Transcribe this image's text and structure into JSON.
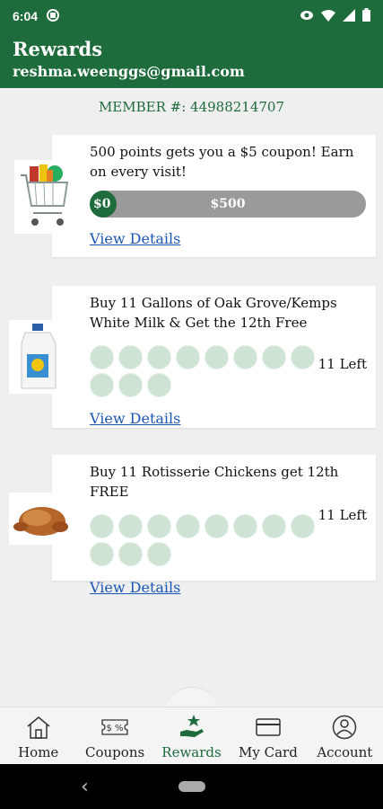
{
  "status": {
    "time": "6:04",
    "icons": [
      "media-icon",
      "eye-icon",
      "wifi-icon",
      "signal-icon",
      "battery-icon"
    ]
  },
  "header": {
    "title": "Rewards",
    "email": "reshma.weenggs@gmail.com"
  },
  "member": {
    "label": "MEMBER #: 44988214707"
  },
  "cards": [
    {
      "title": "500 points gets you a $5 coupon! Earn on every visit!",
      "image": "shopping-cart-image",
      "progress_start": "$0",
      "progress_end": "$500",
      "progress_fraction": 0.03,
      "link": "View Details"
    },
    {
      "title": "Buy 11 Gallons of Oak Grove/Kemps White Milk & Get the 12th Free",
      "image": "milk-gallon-image",
      "stamps_total": 11,
      "stamps_filled": 0,
      "left_text": "11 Left",
      "link": "View Details"
    },
    {
      "title": "Buy 11 Rotisserie Chickens get 12th FREE",
      "image": "rotisserie-chicken-image",
      "stamps_total": 11,
      "stamps_filled": 0,
      "left_text": "11 Left",
      "link": "View Details"
    }
  ],
  "nav": {
    "items": [
      {
        "label": "Home",
        "icon": "home-icon"
      },
      {
        "label": "Coupons",
        "icon": "coupon-icon"
      },
      {
        "label": "Rewards",
        "icon": "rewards-hand-star-icon"
      },
      {
        "label": "My Card",
        "icon": "card-icon"
      },
      {
        "label": "Account",
        "icon": "account-icon"
      }
    ],
    "active": "Rewards"
  },
  "colors": {
    "brand_green": "#1e6b3c",
    "link_blue": "#1a56b3",
    "stamp_fill": "#cfe3d5",
    "progress_track": "#9a9a9a"
  }
}
